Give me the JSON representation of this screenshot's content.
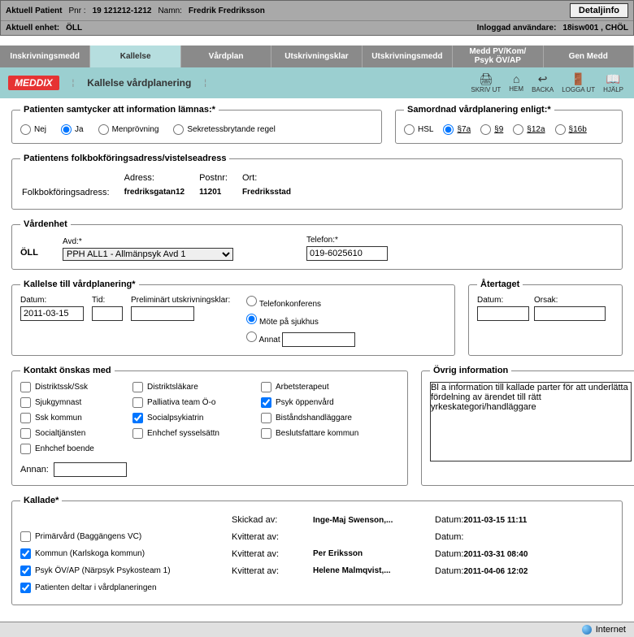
{
  "header": {
    "aktuell_patient_lbl": "Aktuell Patient",
    "pnr_lbl": "Pnr :",
    "pnr": "19 121212-1212",
    "namn_lbl": "Namn:",
    "namn": "Fredrik Fredriksson",
    "detaljinfo_btn": "Detaljinfo",
    "enhet_lbl": "Aktuell enhet:",
    "enhet": "ÖLL",
    "inloggad_lbl": "Inloggad användare:",
    "inloggad": "18isw001 , CHÖL"
  },
  "tabs": {
    "t0": "Inskrivningsmedd",
    "t1": "Kallelse",
    "t2": "Vårdplan",
    "t3": "Utskrivningsklar",
    "t4": "Utskrivningsmedd",
    "t5": "Medd PV/Kom/\nPsyk ÖV/AP",
    "t6": "Gen Medd"
  },
  "pillbar": {
    "brand": "MEDDIX",
    "title": "Kallelse vårdplanering",
    "skriv_ut": "SKRIV UT",
    "hem": "HEM",
    "backa": "BACKA",
    "logga_ut": "LOGGA UT",
    "hjalp": "HJÄLP"
  },
  "samtycke": {
    "legend": "Patienten samtycker att information lämnas:*",
    "nej": "Nej",
    "ja": "Ja",
    "men": "Menprövning",
    "sekr": "Sekretessbrytande regel"
  },
  "samordnad": {
    "legend": "Samordnad vårdplanering enligt:*",
    "hsl": "HSL",
    "s7a": "§7a",
    "s9": "§9",
    "s12a": "§12a",
    "s16b": "§16b"
  },
  "folkbok": {
    "legend": "Patientens folkbokföringsadress/vistelseadress",
    "adress_lbl": "Adress:",
    "postnr_lbl": "Postnr:",
    "ort_lbl": "Ort:",
    "row_lbl": "Folkbokföringsadress:",
    "adress": "fredriksgatan12",
    "postnr": "11201",
    "ort": "Fredriksstad"
  },
  "vardenhet": {
    "legend": "Vårdenhet",
    "oll": "ÖLL",
    "avd_lbl": "Avd:*",
    "avd": "PPH ALL1 - Allmänpsyk Avd 1",
    "tel_lbl": "Telefon:*",
    "tel": "019-6025610"
  },
  "kallelse": {
    "legend": "Kallelse till vårdplanering*",
    "datum_lbl": "Datum:",
    "datum": "2011-03-15",
    "tid_lbl": "Tid:",
    "tid": "",
    "prel_lbl": "Preliminärt utskrivningsklar:",
    "telekonf": "Telefonkonferens",
    "mote": "Möte på sjukhus",
    "annat": "Annat"
  },
  "atertaget": {
    "legend": "Återtaget",
    "datum_lbl": "Datum:",
    "orsak_lbl": "Orsak:"
  },
  "kontakt": {
    "legend": "Kontakt önskas med",
    "c00": "Distriktssk/Ssk",
    "c01": "Distriktsläkare",
    "c02": "Arbetsterapeut",
    "c10": "Sjukgymnast",
    "c11": "Palliativa team Ö-o",
    "c12": "Psyk öppenvård",
    "c20": "Ssk kommun",
    "c21": "Socialpsykiatrin",
    "c22": "Biståndshandläggare",
    "c30": "Socialtjänsten",
    "c31": "Enhchef sysselsättn",
    "c32": "Beslutsfattare kommun",
    "c40": "Enhchef boende",
    "annan_lbl": "Annan:"
  },
  "ovrig": {
    "legend": "Övrig information",
    "text": "Bl a information till kallade parter för att underlätta fördelning av ärendet till rätt yrkeskategori/handläggare"
  },
  "kallade": {
    "legend": "Kallade*",
    "skickad_av": "Skickad av:",
    "kvitterat_av": "Kvitterat av:",
    "datum_lbl": "Datum:",
    "r0_name": "Inge-Maj Swenson,...",
    "r0_date": "2011-03-15 11:11",
    "r1_chk": "Primärvård (Baggängens VC)",
    "r2_chk": "Kommun (Karlskoga kommun)",
    "r2_name": "Per Eriksson",
    "r2_date": "2011-03-31 08:40",
    "r3_chk": "Psyk ÖV/AP (Närpsyk Psykosteam 1)",
    "r3_name": "Helene Malmqvist,...",
    "r3_date": "2011-04-06 12:02",
    "r4_chk": "Patienten deltar i vårdplaneringen"
  },
  "status": {
    "internet": "Internet"
  }
}
